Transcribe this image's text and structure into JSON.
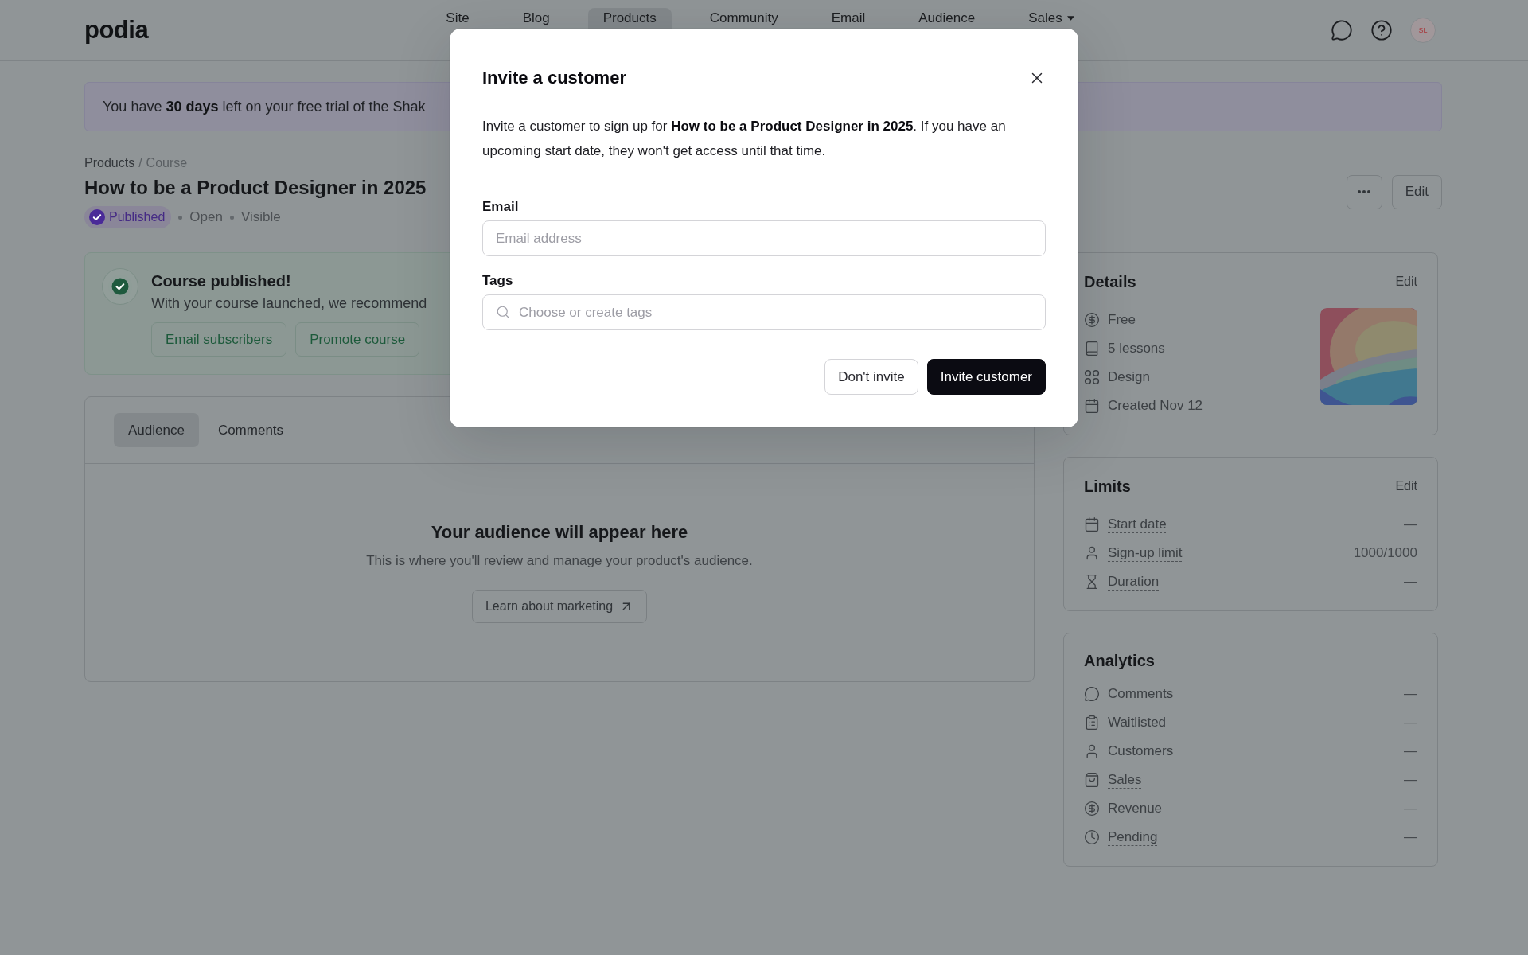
{
  "nav": {
    "logo": "podia",
    "items": [
      {
        "label": "Site",
        "selected": false,
        "dropdown": false
      },
      {
        "label": "Blog",
        "selected": false,
        "dropdown": false
      },
      {
        "label": "Products",
        "selected": true,
        "dropdown": false
      },
      {
        "label": "Community",
        "selected": false,
        "dropdown": false
      },
      {
        "label": "Email",
        "selected": false,
        "dropdown": false
      },
      {
        "label": "Audience",
        "selected": false,
        "dropdown": false
      },
      {
        "label": "Sales",
        "selected": false,
        "dropdown": true
      }
    ],
    "avatar": {
      "initials": "SL"
    }
  },
  "trial_banner": {
    "text": "You have **30 days** left on your free trial of the Shak"
  },
  "breadcrumb": {
    "items": [
      {
        "label": "Products",
        "current": false
      },
      {
        "label": "Course",
        "current": true
      }
    ],
    "separator": "/"
  },
  "product": {
    "title": "How to be a Product Designer in 2025",
    "status": "Published",
    "meta": [
      "Open",
      "Visible"
    ],
    "edit": "Edit"
  },
  "announcement": {
    "title": "Course published!",
    "text": "With your course launched, we recommend",
    "buttons": [
      "Email subscribers",
      "Promote course"
    ]
  },
  "tabs": [
    {
      "label": "Audience",
      "selected": true
    },
    {
      "label": "Comments",
      "selected": false
    }
  ],
  "empty_state": {
    "title": "Your audience will appear here",
    "text": "This is where you'll review and manage your product's audience.",
    "button": "Learn about marketing"
  },
  "details": {
    "title": "Details",
    "edit": "Edit",
    "rows": [
      {
        "kind": "price",
        "label": "Free"
      },
      {
        "kind": "lessons",
        "label": "5 lessons"
      },
      {
        "kind": "category",
        "label": "Design"
      },
      {
        "kind": "created",
        "label": "Created Nov 12"
      }
    ]
  },
  "limits": {
    "title": "Limits",
    "edit": "Edit",
    "rows": [
      {
        "kind": "start_date",
        "label": "Start date",
        "value": "—",
        "underlined": true
      },
      {
        "kind": "signup_limit",
        "label": "Sign-up limit",
        "value": "1000/1000",
        "underlined": true
      },
      {
        "kind": "duration",
        "label": "Duration",
        "value": "—",
        "underlined": true
      }
    ]
  },
  "analytics": {
    "title": "Analytics",
    "rows": [
      {
        "kind": "comments",
        "label": "Comments",
        "value": "—",
        "underlined": false
      },
      {
        "kind": "waitlist",
        "label": "Waitlisted",
        "value": "—",
        "underlined": false
      },
      {
        "kind": "customers",
        "label": "Customers",
        "value": "—",
        "underlined": false
      },
      {
        "kind": "sales",
        "label": "Sales",
        "value": "—",
        "underlined": true
      },
      {
        "kind": "revenue",
        "label": "Revenue",
        "value": "—",
        "underlined": false
      },
      {
        "kind": "pending",
        "label": "Pending",
        "value": "—",
        "underlined": true
      }
    ]
  },
  "modal": {
    "title": "Invite a customer",
    "description": "Invite a customer to sign up for **How to be a Product Designer in 2025**. If you have an upcoming start date, they won't get access until that time.",
    "fields": [
      {
        "kind": "text",
        "label": "Email",
        "placeholder": "Email address"
      },
      {
        "kind": "search",
        "label": "Tags",
        "placeholder": "Choose or create tags"
      }
    ],
    "buttons": [
      {
        "kind": "secondary",
        "label": "Don't invite"
      },
      {
        "kind": "primary",
        "label": "Invite customer"
      }
    ]
  }
}
